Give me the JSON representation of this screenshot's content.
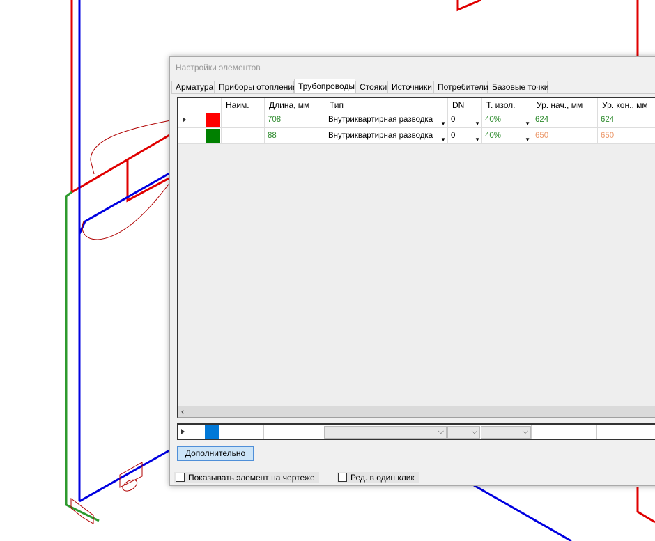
{
  "dialog": {
    "title": "Настройки элементов",
    "tabs": [
      "Арматура",
      "Приборы отопления",
      "Трубопроводы",
      "Стояки",
      "Источники",
      "Потребители",
      "Базовые точки"
    ],
    "active_tab": "Трубопроводы"
  },
  "grid": {
    "columns": [
      "Наим.",
      "Длина, мм",
      "Тип",
      "DN",
      "Т. изол.",
      "Ур. нач., мм",
      "Ур. кон., мм"
    ],
    "rows": [
      {
        "color": "#ff0000",
        "name": "",
        "length": "708",
        "type": "Внутриквартирная разводка",
        "dn": "0",
        "insul": "40%",
        "lvl_start": "624",
        "lvl_end": "624"
      },
      {
        "color": "#008000",
        "name": "",
        "length": "88",
        "type": "Внутриквартирная разводка",
        "dn": "0",
        "insul": "40%",
        "lvl_start": "650",
        "lvl_end": "650"
      }
    ],
    "new_row_color": "#0078d7"
  },
  "buttons": {
    "more": "Дополнительно"
  },
  "checkboxes": {
    "show_on_drawing": "Показывать элемент на чертеже",
    "edit_one_click": "Ред. в один клик"
  },
  "colors": {
    "accent": "#4f8fd8",
    "pipe_red": "#ff0000",
    "pipe_blue": "#0000ff",
    "pipe_green": "#2e8b2e"
  }
}
